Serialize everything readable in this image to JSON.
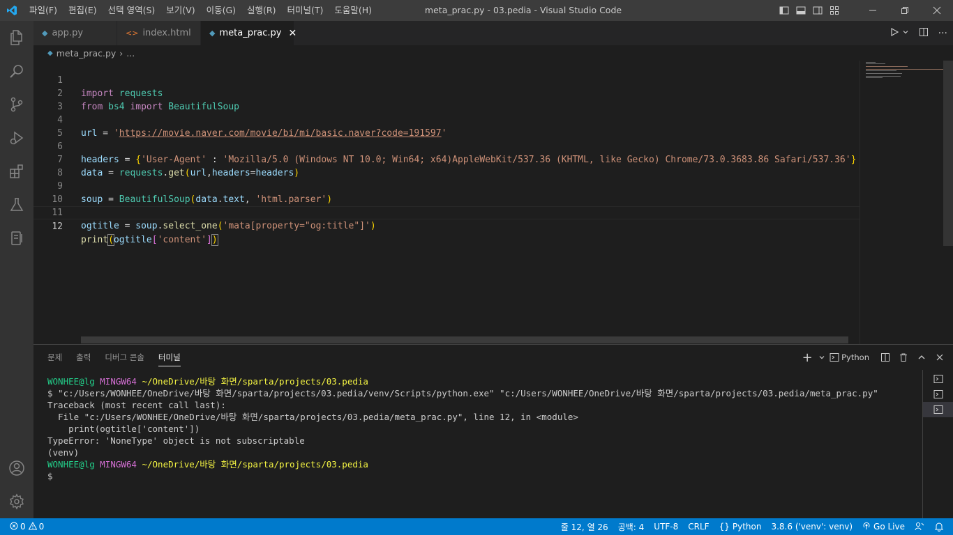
{
  "titlebar": {
    "menu": [
      "파일(F)",
      "편집(E)",
      "선택 영역(S)",
      "보기(V)",
      "이동(G)",
      "실행(R)",
      "터미널(T)",
      "도움말(H)"
    ],
    "title": "meta_prac.py - 03.pedia - Visual Studio Code"
  },
  "tabs": [
    {
      "label": "app.py",
      "icon": "python-file-icon"
    },
    {
      "label": "index.html",
      "icon": "html-file-icon"
    },
    {
      "label": "meta_prac.py",
      "icon": "python-file-icon",
      "active": true
    }
  ],
  "breadcrumb": {
    "file": "meta_prac.py",
    "more": "..."
  },
  "editor": {
    "line_numbers": [
      "1",
      "2",
      "3",
      "4",
      "5",
      "6",
      "7",
      "8",
      "9",
      "10",
      "11",
      "12"
    ],
    "current_line": 12,
    "code": {
      "l1": {
        "kw": "import",
        "mod": "requests"
      },
      "l2": {
        "kw1": "from",
        "mod": "bs4",
        "kw2": "import",
        "cls": "BeautifulSoup"
      },
      "l4": {
        "var": "url",
        "eq": " = ",
        "q1": "'",
        "url": "https://movie.naver.com/movie/bi/mi/basic.naver?code=191597",
        "q2": "'"
      },
      "l6": {
        "var": "headers",
        "eq": " = ",
        "ob": "{",
        "key": "'User-Agent'",
        "colon": " : ",
        "val": "'Mozilla/5.0 (Windows NT 10.0; Win64; x64)AppleWebKit/537.36 (KHTML, like Gecko) Chrome/73.0.3683.86 Safari/537.36'",
        "cb": "}"
      },
      "l7": {
        "var": "data",
        "eq": " = ",
        "mod": "requests",
        "dot": ".",
        "fn": "get",
        "op": "(",
        "a1": "url",
        "comma": ",",
        "a2": "headers",
        "eq2": "=",
        "a3": "headers",
        "cp": ")"
      },
      "l9": {
        "var": "soup",
        "eq": " = ",
        "cls": "BeautifulSoup",
        "op": "(",
        "a1": "data",
        "dot": ".",
        "a2": "text",
        "comma": ", ",
        "str": "'html.parser'",
        "cp": ")"
      },
      "l11": {
        "var": "ogtitle",
        "eq": " = ",
        "obj": "soup",
        "dot": ".",
        "fn": "select_one",
        "op": "(",
        "str": "'mata[property=\"og:title\"]'",
        "cp": ")"
      },
      "l12": {
        "fn": "print",
        "op": "(",
        "var": "ogtitle",
        "ob": "[",
        "str": "'content'",
        "cb": "]",
        "cp": ")"
      }
    }
  },
  "panel": {
    "tabs": [
      "문제",
      "출력",
      "디버그 콘솔",
      "터미널"
    ],
    "active_tab": "터미널",
    "shell_name": "Python",
    "terminal": {
      "prompt1": {
        "user": "WONHEE@lg",
        "env": "MINGW64",
        "path": "~/OneDrive/바탕 화면/sparta/projects/03.pedia"
      },
      "cmd": "$ \"c:/Users/WONHEE/OneDrive/바탕 화면/sparta/projects/03.pedia/venv/Scripts/python.exe\" \"c:/Users/WONHEE/OneDrive/바탕 화면/sparta/projects/03.pedia/meta_prac.py\"",
      "traceback": "Traceback (most recent call last):",
      "file_line": "  File \"c:/Users/WONHEE/OneDrive/바탕 화면/sparta/projects/03.pedia/meta_prac.py\", line 12, in <module>",
      "code_line": "    print(ogtitle['content'])",
      "error": "TypeError: 'NoneType' object is not subscriptable",
      "venv": "(venv)",
      "prompt2": {
        "user": "WONHEE@lg",
        "env": "MINGW64",
        "path": "~/OneDrive/바탕 화면/sparta/projects/03.pedia"
      },
      "dollar": "$"
    }
  },
  "statusbar": {
    "errors": "0",
    "warnings": "0",
    "position": "줄 12, 열 26",
    "indent": "공백: 4",
    "encoding": "UTF-8",
    "eol": "CRLF",
    "language": "Python",
    "interpreter": "3.8.6 ('venv': venv)",
    "golive": "Go Live"
  },
  "colors": {
    "accent": "#007acc",
    "titlebar": "#3c3c3c",
    "activitybar": "#333333",
    "editor_bg": "#1e1e1e"
  }
}
